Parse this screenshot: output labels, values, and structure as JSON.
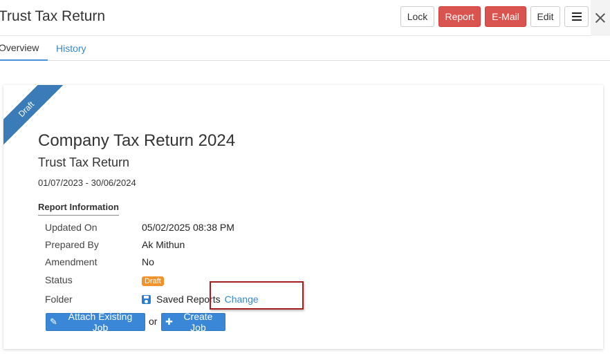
{
  "header": {
    "title": "Trust Tax Return",
    "buttons": {
      "lock": "Lock",
      "report": "Report",
      "email": "E-Mail",
      "edit": "Edit"
    }
  },
  "tabs": [
    {
      "label": "Overview",
      "active": true
    },
    {
      "label": "History",
      "active": false
    }
  ],
  "card": {
    "ribbon": "Draft",
    "title": "Company Tax Return 2024",
    "subtitle": "Trust Tax Return",
    "dates": "01/07/2023 - 30/06/2024",
    "section_heading": "Report Information",
    "rows": [
      {
        "label": "Updated On",
        "value": "05/02/2025 08:38 PM"
      },
      {
        "label": "Prepared By",
        "value": "Ak Mithun"
      },
      {
        "label": "Amendment",
        "value": "No"
      },
      {
        "label": "Status",
        "value": "Draft"
      },
      {
        "label": "Folder",
        "value": "Saved Reports",
        "link": "Change"
      }
    ],
    "actions": {
      "attach": "Attach Existing Job",
      "or": "or",
      "create": "Create Job"
    }
  },
  "colors": {
    "accent": "#3a87c8",
    "danger": "#d9534f",
    "ribbon": "#3a7bb8",
    "badge": "#f0932b",
    "highlight": "#a31d1d"
  },
  "icons": {
    "menu": "hamburger-icon",
    "close": "close-icon",
    "folder": "save-icon",
    "attach": "paperclip-icon",
    "create": "plus-icon"
  }
}
